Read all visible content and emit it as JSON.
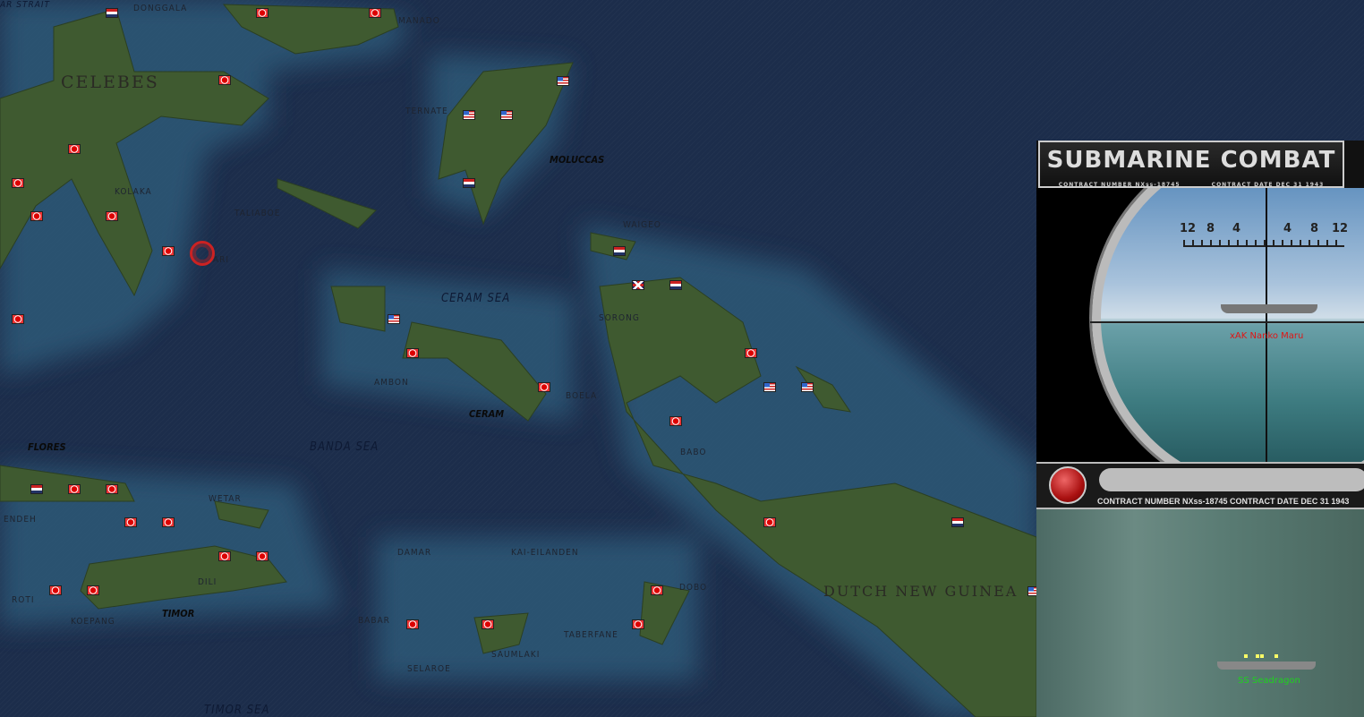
{
  "map": {
    "labels": {
      "ar_strait": "AR STRAIT",
      "donggala": "DONGGALA",
      "manado": "MANADO",
      "celebes": "CELEBES",
      "ternate": "TERNATE",
      "moluccas": "MOLUCCAS",
      "kolaka": "KOLAKA",
      "taliaboe": "TALIABOE",
      "waigeo": "WAIGEO",
      "ari": "ARI",
      "ceram_sea": "CERAM SEA",
      "sorong": "SORONG",
      "ambon": "AMBON",
      "boela": "BOELA",
      "ceram": "CERAM",
      "flores": "FLORES",
      "banda_sea": "BANDA SEA",
      "babo": "BABO",
      "wetar": "WETAR",
      "endeh": "ENDEH",
      "damar": "DAMAR",
      "kai_eilanden": "KAI-EILANDEN",
      "dili": "DILI",
      "dobo": "DOBO",
      "dutch_new_guinea": "DUTCH NEW GUINEA",
      "roti": "ROTI",
      "timor": "TIMOR",
      "koepang": "KOEPANG",
      "babar": "BABAR",
      "taberfane": "TABERFANE",
      "saumlaki": "SAUMLAKI",
      "selaroe": "SELAROE",
      "timor_sea": "TIMOR SEA"
    }
  },
  "combat": {
    "title": "SUBMARINE COMBAT",
    "contract_number": "CONTRACT NUMBER   NXss-18745",
    "contract_date": "CONTRACT DATE  DEC 31 1943",
    "bottom_contract": "CONTRACT NUMBER   NXss-18745      CONTRACT DATE  DEC 31 1943",
    "reticle_ticks": [
      "12",
      "8",
      "4",
      "4",
      "8",
      "12"
    ],
    "target_name": "xAK Nanko Maru",
    "submarine_name": "SS Seadragon",
    "colors": {
      "target": "#e01515",
      "submarine": "#1fd11f"
    }
  }
}
